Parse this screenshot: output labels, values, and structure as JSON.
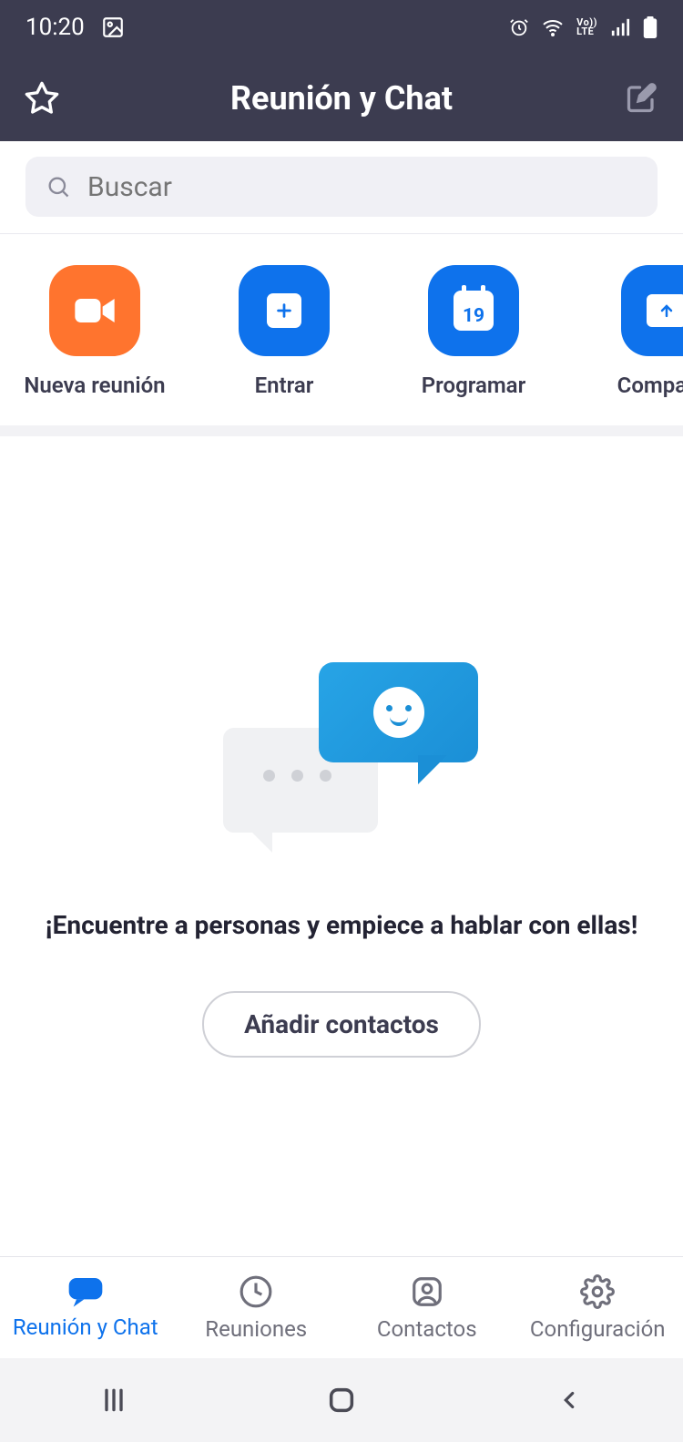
{
  "status": {
    "time": "10:20"
  },
  "header": {
    "title": "Reunión y Chat"
  },
  "search": {
    "placeholder": "Buscar"
  },
  "actions": {
    "items": [
      {
        "label": "Nueva reunión"
      },
      {
        "label": "Entrar"
      },
      {
        "label": "Programar",
        "day": "19"
      },
      {
        "label": "Compartir"
      }
    ]
  },
  "empty": {
    "title": "¡Encuentre a personas y empiece a hablar con ellas!",
    "add_button": "Añadir contactos"
  },
  "tabs": {
    "items": [
      {
        "label": "Reunión y Chat"
      },
      {
        "label": "Reuniones"
      },
      {
        "label": "Contactos"
      },
      {
        "label": "Configuración"
      }
    ]
  }
}
